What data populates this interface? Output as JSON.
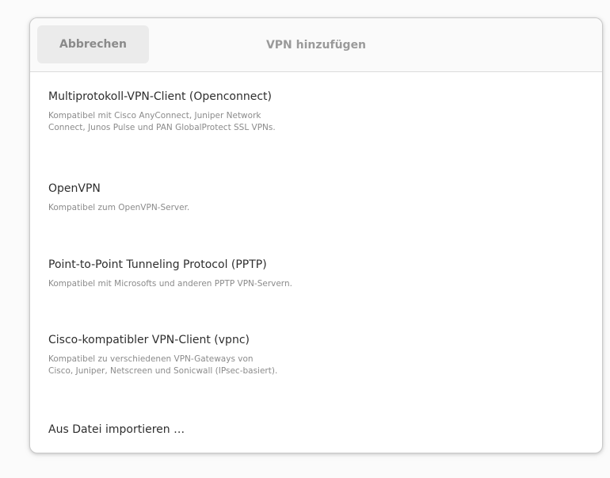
{
  "dialog": {
    "title": "VPN hinzufügen",
    "cancel_label": "Abbrechen"
  },
  "vpn_types": [
    {
      "title": "Multiprotokoll-VPN-Client (Openconnect)",
      "description": "Kompatibel mit Cisco AnyConnect, Juniper Network\nConnect, Junos Pulse und PAN GlobalProtect SSL VPNs."
    },
    {
      "title": "OpenVPN",
      "description": "Kompatibel zum OpenVPN-Server."
    },
    {
      "title": "Point-to-Point Tunneling Protocol (PPTP)",
      "description": "Kompatibel mit Microsofts und anderen PPTP VPN-Servern."
    },
    {
      "title": "Cisco-kompatibler VPN-Client (vpnc)",
      "description": "Kompatibel zu verschiedenen VPN-Gateways von\nCisco, Juniper, Netscreen und Sonicwall (IPsec-basiert)."
    }
  ],
  "import": {
    "label": "Aus Datei importieren …"
  }
}
